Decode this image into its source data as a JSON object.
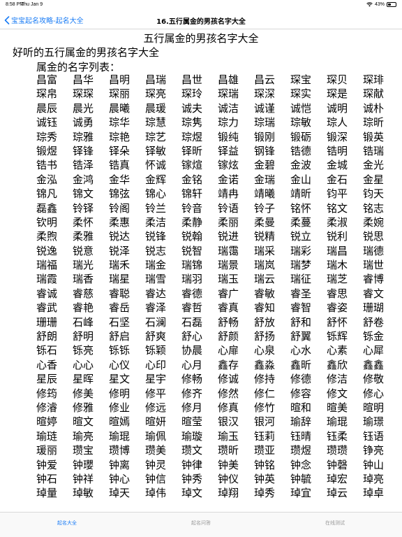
{
  "status_bar": {
    "time": "8:58 PM",
    "date": "Thu Jan 9",
    "battery": "43%",
    "battery_level": 0.43
  },
  "nav": {
    "back_label": "宝宝起名攻略-起名大全",
    "title": "16.五行属金的男孩名字大全"
  },
  "article": {
    "title": "五行属金的男孩名字大全",
    "subtitle": "好听的五行属金的男孩名字大全",
    "list_heading": "属金的名字列表：",
    "names": [
      "昌富",
      "昌华",
      "昌明",
      "昌瑞",
      "昌世",
      "昌雄",
      "昌云",
      "琛宝",
      "琛贝",
      "琛琲",
      "琛帛",
      "琛琛",
      "琛丽",
      "琛亮",
      "琛玲",
      "琛瑞",
      "琛深",
      "琛实",
      "琛是",
      "琛献",
      "晨辰",
      "晨光",
      "晨曦",
      "晨瑗",
      "诚夫",
      "诚洁",
      "诚谨",
      "诚恺",
      "诚明",
      "诚朴",
      "诚钰",
      "诚勇",
      "琮华",
      "琮慧",
      "琮隽",
      "琮力",
      "琮瑞",
      "琮敏",
      "琮人",
      "琮昕",
      "琮秀",
      "琮雅",
      "琮艳",
      "琮艺",
      "琮煜",
      "锻纯",
      "锻刚",
      "锻砺",
      "锻深",
      "锻英",
      "锻煜",
      "铎锋",
      "铎朵",
      "铎敏",
      "铎昕",
      "铎益",
      "钢锋",
      "锆德",
      "锆明",
      "锆瑞",
      "锆书",
      "锆泽",
      "锆真",
      "怀诚",
      "镓煊",
      "镓炫",
      "金碧",
      "金波",
      "金城",
      "金光",
      "金泓",
      "金鸿",
      "金华",
      "金辉",
      "金铭",
      "金诺",
      "金瑞",
      "金山",
      "金石",
      "金星",
      "锦凡",
      "锦文",
      "锦弦",
      "锦心",
      "锦轩",
      "靖冉",
      "靖曦",
      "靖昕",
      "钧平",
      "钧天",
      "磊鑫",
      "铃铎",
      "铃阁",
      "铃兰",
      "铃音",
      "铃语",
      "铃子",
      "铭怀",
      "铭文",
      "铭志",
      "钦明",
      "柔怀",
      "柔惠",
      "柔洁",
      "柔静",
      "柔丽",
      "柔曼",
      "柔蔓",
      "柔淑",
      "柔婉",
      "柔煦",
      "柔雅",
      "锐达",
      "锐锋",
      "锐翰",
      "锐进",
      "锐精",
      "锐立",
      "锐利",
      "锐思",
      "锐逸",
      "锐意",
      "锐泽",
      "锐志",
      "锐智",
      "瑞霭",
      "瑞采",
      "瑞彩",
      "瑞昌",
      "瑞德",
      "瑞福",
      "瑞光",
      "瑞禾",
      "瑞金",
      "瑞锦",
      "瑞景",
      "瑞岚",
      "瑞梦",
      "瑞木",
      "瑞世",
      "瑞霞",
      "瑞香",
      "瑞星",
      "瑞雪",
      "瑞羽",
      "瑞玉",
      "瑞云",
      "瑞征",
      "瑞芝",
      "睿博",
      "睿诚",
      "睿慈",
      "睿聪",
      "睿达",
      "睿德",
      "睿广",
      "睿敏",
      "睿圣",
      "睿思",
      "睿文",
      "睿武",
      "睿艳",
      "睿岳",
      "睿泽",
      "睿哲",
      "睿真",
      "睿知",
      "睿智",
      "睿姿",
      "珊瑚",
      "珊珊",
      "石峰",
      "石坚",
      "石澜",
      "石磊",
      "舒畅",
      "舒放",
      "舒和",
      "舒怀",
      "舒卷",
      "舒朗",
      "舒明",
      "舒启",
      "舒爽",
      "舒心",
      "舒颜",
      "舒扬",
      "舒翼",
      "铄辉",
      "铄金",
      "铄石",
      "铄亮",
      "铄铄",
      "铄颖",
      "协晨",
      "心扉",
      "心泉",
      "心水",
      "心素",
      "心犀",
      "心香",
      "心心",
      "心仪",
      "心印",
      "心月",
      "鑫存",
      "鑫淼",
      "鑫昕",
      "鑫欣",
      "鑫鑫",
      "星辰",
      "星晖",
      "星文",
      "星宇",
      "修畅",
      "修诚",
      "修持",
      "修德",
      "修洁",
      "修敬",
      "修筠",
      "修美",
      "修明",
      "修平",
      "修齐",
      "修然",
      "修仁",
      "修容",
      "修文",
      "修心",
      "修濬",
      "修雅",
      "修业",
      "修远",
      "修月",
      "修真",
      "修竹",
      "暄和",
      "暄美",
      "暄明",
      "暄婷",
      "暄文",
      "暄嫣",
      "暄妍",
      "暄莹",
      "银汉",
      "银河",
      "瑜辞",
      "瑜琨",
      "瑜璟",
      "瑜琏",
      "瑜亮",
      "瑜琨",
      "瑜佩",
      "瑜璇",
      "瑜玉",
      "钰莉",
      "钰晴",
      "钰柔",
      "钰语",
      "瑗丽",
      "瓒宝",
      "瓒博",
      "瓒美",
      "瓒文",
      "瓒昕",
      "瓒亚",
      "瓒煜",
      "瓒瓒",
      "铮亮",
      "钟爱",
      "钟瓔",
      "钟离",
      "钟灵",
      "钟律",
      "钟美",
      "钟铭",
      "钟念",
      "钟磬",
      "钟山",
      "钟石",
      "钟祥",
      "钟心",
      "钟信",
      "钟秀",
      "钟仪",
      "钟英",
      "钟毓",
      "琸宏",
      "琸亮",
      "琸量",
      "琸敏",
      "琸天",
      "琸伟",
      "琸文",
      "琸翔",
      "琸秀",
      "琸宜",
      "琸云",
      "琸卓"
    ]
  },
  "tabs": [
    {
      "label": "起名大全",
      "active": true
    },
    {
      "label": "起名问答",
      "active": false
    },
    {
      "label": "在线测试",
      "active": false
    }
  ],
  "colors": {
    "accent": "#1a7cf5",
    "inactive_tab": "#999999"
  }
}
